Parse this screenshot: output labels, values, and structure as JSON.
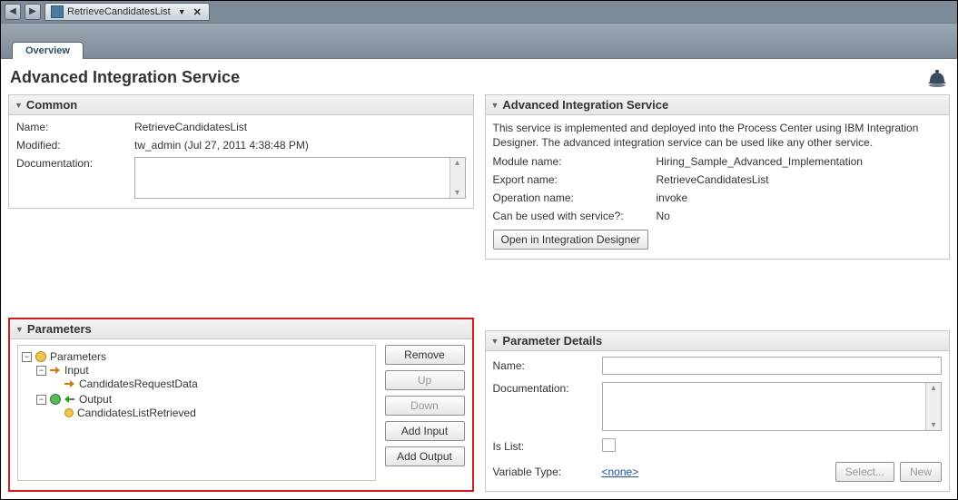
{
  "window": {
    "tab_title": "RetrieveCandidatesList"
  },
  "overview_tab_label": "Overview",
  "page_title": "Advanced Integration Service",
  "common": {
    "section_title": "Common",
    "labels": {
      "name": "Name:",
      "modified": "Modified:",
      "documentation": "Documentation:"
    },
    "name_value": "RetrieveCandidatesList",
    "modified_value": "tw_admin (Jul 27, 2011 4:38:48 PM)"
  },
  "ais": {
    "section_title": "Advanced Integration Service",
    "description": "This service is implemented and deployed into the Process Center using IBM Integration Designer. The advanced integration service can be used like any other service.",
    "labels": {
      "module_name": "Module name:",
      "export_name": "Export name:",
      "operation_name": "Operation name:",
      "can_be_used": "Can be used with service?:"
    },
    "module_name_value": "Hiring_Sample_Advanced_Implementation",
    "export_name_value": "RetrieveCandidatesList",
    "operation_name_value": "invoke",
    "can_be_used_value": "No",
    "open_designer_label": "Open in Integration Designer"
  },
  "parameters": {
    "section_title": "Parameters",
    "tree": {
      "root": "Parameters",
      "input_label": "Input",
      "input_items": [
        "CandidatesRequestData"
      ],
      "output_label": "Output",
      "output_items": [
        "CandidatesListRetrieved"
      ]
    },
    "buttons": {
      "remove": "Remove",
      "up": "Up",
      "down": "Down",
      "add_input": "Add Input",
      "add_output": "Add Output"
    }
  },
  "parameter_details": {
    "section_title": "Parameter Details",
    "labels": {
      "name": "Name:",
      "documentation": "Documentation:",
      "is_list": "Is List:",
      "variable_type": "Variable Type:"
    },
    "variable_type_value": "<none>",
    "select_label": "Select...",
    "new_label": "New"
  }
}
